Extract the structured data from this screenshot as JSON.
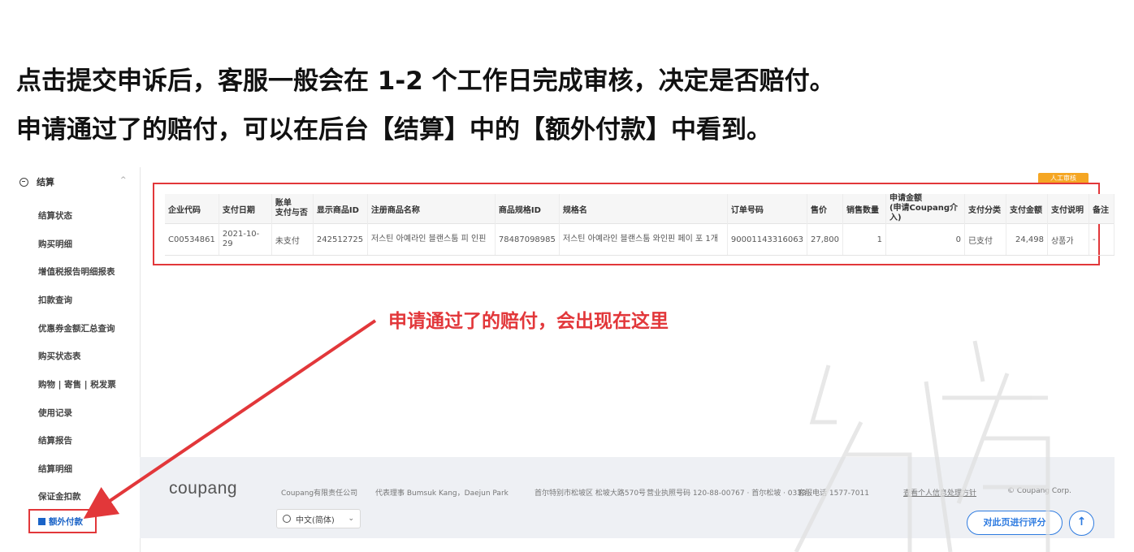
{
  "headings": {
    "line1": "点击提交申诉后，客服一般会在 1-2 个工作日完成审核，决定是否赔付。",
    "line2": "申请通过了的赔付，可以在后台【结算】中的【额外付款】中看到。"
  },
  "sidebar": {
    "section_title": "结算",
    "items": [
      "结算状态",
      "购买明细",
      "增值税报告明细报表",
      "扣款查询",
      "优惠券金额汇总查询",
      "购买状态表",
      "购物 | 寄售 | 税发票",
      "使用记录",
      "结算报告",
      "结算明细",
      "保证金扣款"
    ],
    "active_item": "额外付款"
  },
  "table": {
    "badge": "人工审核",
    "headers": [
      "企业代码",
      "支付日期",
      "账单\n支付与否",
      "显示商品ID",
      "注册商品名称",
      "商品规格ID",
      "规格名",
      "订单号码",
      "售价",
      "销售数量",
      "申请金额\n(申请Coupang介入)",
      "支付分类",
      "支付金额",
      "支付说明",
      "备注"
    ],
    "rows": [
      [
        "C00534861",
        "2021-10-29",
        "未支付",
        "242512725",
        "저스틴 아예라인 블랜스툼 피 인핀",
        "78487098985",
        "저스틴 아예라인 블랜스툼 와인핀 페이 포 1개",
        "90001143316063",
        "27,800",
        "1",
        "0",
        "已支付",
        "24,498",
        "상품가",
        "-"
      ]
    ]
  },
  "annotation": "申请通过了的赔付，会出现在这里",
  "footer": {
    "logo": "coupang",
    "company": "Coupang有限责任公司",
    "ceo": "代表理事  Bumsuk Kang，Daejun Park",
    "address": "首尔特别市松坡区 松坡大路570号",
    "business_no": "营业执照号码 120-88-00767 · 首尔松坡 · 0333",
    "phone": "客服电话 1577-7011",
    "privacy": "查看个人信息处理方针",
    "copyright": "© Coupang Corp.",
    "language": "中文(简体)",
    "rate_button": "对此页进行评分",
    "up_icon": "↑"
  },
  "colors": {
    "annotation_red": "#e2373a",
    "link_blue": "#2e7be0",
    "badge_orange": "#f5a623"
  }
}
